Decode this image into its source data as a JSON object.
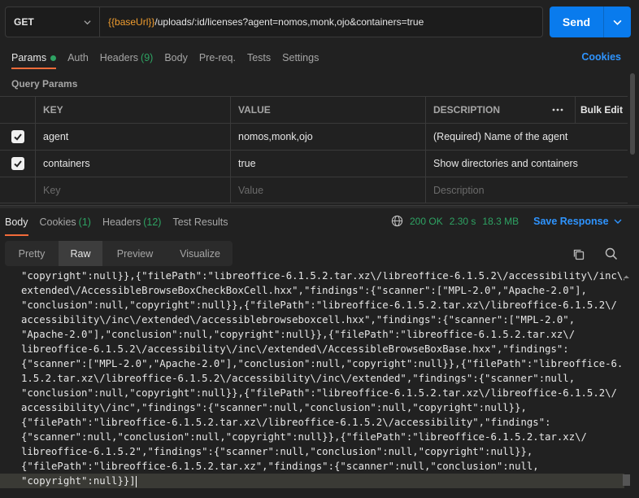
{
  "request": {
    "method": "GET",
    "url_var": "{{baseUrl}}",
    "url_rest": "/uploads/:id/licenses?agent=nomos,monk,ojo&containers=true",
    "send_label": "Send"
  },
  "req_tabs": {
    "params": "Params",
    "auth": "Auth",
    "headers": "Headers",
    "headers_count": "(9)",
    "body": "Body",
    "prereq": "Pre-req.",
    "tests": "Tests",
    "settings": "Settings",
    "cookies": "Cookies"
  },
  "query_params": {
    "title": "Query Params",
    "headers": {
      "key": "KEY",
      "value": "VALUE",
      "description": "DESCRIPTION",
      "bulk_edit": "Bulk Edit"
    },
    "rows": [
      {
        "key": "agent",
        "value": "nomos,monk,ojo",
        "description": "(Required) Name of the agent"
      },
      {
        "key": "containers",
        "value": "true",
        "description": "Show directories and containers"
      }
    ],
    "placeholders": {
      "key": "Key",
      "value": "Value",
      "description": "Description"
    }
  },
  "response": {
    "tabs": {
      "body": "Body",
      "cookies": "Cookies",
      "cookies_count": "(1)",
      "headers": "Headers",
      "headers_count": "(12)",
      "test_results": "Test Results"
    },
    "status": "200 OK",
    "time": "2.30 s",
    "size": "18.3 MB",
    "save_label": "Save Response",
    "modes": {
      "pretty": "Pretty",
      "raw": "Raw",
      "preview": "Preview",
      "visualize": "Visualize"
    },
    "body_lines": [
      "\"copyright\":null}},{\"filePath\":\"libreoffice-6.1.5.2.tar.xz\\/libreoffice-6.1.5.2\\/accessibility\\/inc\\/",
      "extended\\/AccessibleBrowseBoxCheckBoxCell.hxx\",\"findings\":{\"scanner\":[\"MPL-2.0\",\"Apache-2.0\"],",
      "\"conclusion\":null,\"copyright\":null}},{\"filePath\":\"libreoffice-6.1.5.2.tar.xz\\/libreoffice-6.1.5.2\\/",
      "accessibility\\/inc\\/extended\\/accessiblebrowseboxcell.hxx\",\"findings\":{\"scanner\":[\"MPL-2.0\",",
      "\"Apache-2.0\"],\"conclusion\":null,\"copyright\":null}},{\"filePath\":\"libreoffice-6.1.5.2.tar.xz\\/",
      "libreoffice-6.1.5.2\\/accessibility\\/inc\\/extended\\/AccessibleBrowseBoxBase.hxx\",\"findings\":",
      "{\"scanner\":[\"MPL-2.0\",\"Apache-2.0\"],\"conclusion\":null,\"copyright\":null}},{\"filePath\":\"libreoffice-6.",
      "1.5.2.tar.xz\\/libreoffice-6.1.5.2\\/accessibility\\/inc\\/extended\",\"findings\":{\"scanner\":null,",
      "\"conclusion\":null,\"copyright\":null}},{\"filePath\":\"libreoffice-6.1.5.2.tar.xz\\/libreoffice-6.1.5.2\\/",
      "accessibility\\/inc\",\"findings\":{\"scanner\":null,\"conclusion\":null,\"copyright\":null}},",
      "{\"filePath\":\"libreoffice-6.1.5.2.tar.xz\\/libreoffice-6.1.5.2\\/accessibility\",\"findings\":",
      "{\"scanner\":null,\"conclusion\":null,\"copyright\":null}},{\"filePath\":\"libreoffice-6.1.5.2.tar.xz\\/",
      "libreoffice-6.1.5.2\",\"findings\":{\"scanner\":null,\"conclusion\":null,\"copyright\":null}},",
      "{\"filePath\":\"libreoffice-6.1.5.2.tar.xz\",\"findings\":{\"scanner\":null,\"conclusion\":null,",
      "\"copyright\":null}}]"
    ]
  },
  "colors": {
    "accent_blue": "#097bed",
    "link_blue": "#2e94ff",
    "status_green": "#2ea363",
    "tab_underline": "#f26b3a",
    "url_variable": "#f09d2f"
  },
  "icons": [
    "chevron-down-icon",
    "check-icon",
    "more-horizontal-icon",
    "globe-icon",
    "copy-icon",
    "search-icon"
  ]
}
